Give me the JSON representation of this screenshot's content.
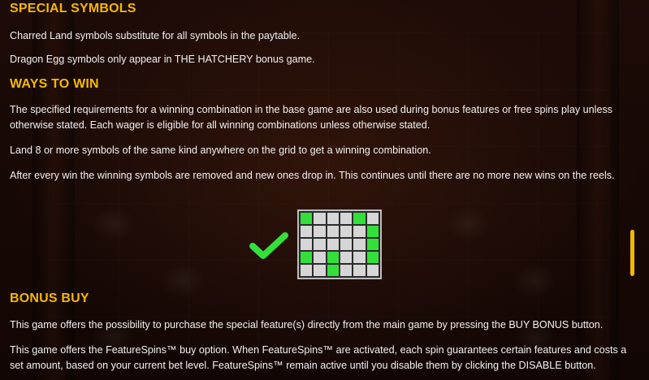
{
  "sections": {
    "special_symbols": {
      "title": "SPECIAL SYMBOLS",
      "p1": "Charred Land symbols substitute for all symbols in the paytable.",
      "p2": "Dragon Egg symbols only appear in THE HATCHERY bonus game."
    },
    "ways_to_win": {
      "title": "WAYS TO WIN",
      "p1": "The specified requirements for a winning combination in the base game are also used during bonus features or free spins play unless otherwise stated. Each wager is eligible for all winning combinations unless otherwise stated.",
      "p2": "Land 8 or more symbols of the same kind anywhere on the grid to get a winning combination.",
      "p3": "After every win the winning symbols are removed and new ones drop in. This continues until there are no more new wins on the reels."
    },
    "bonus_buy": {
      "title": "BONUS BUY",
      "p1": "This game offers the possibility to purchase the special feature(s) directly from the main game by pressing the BUY BONUS button.",
      "p2": "This game offers the FeatureSpins™ buy option. When FeatureSpins™ are activated, each spin guarantees certain features and costs a set amount, based on your current bet level. FeatureSpins™ remain active until you disable them by clicking the DISABLE button."
    }
  },
  "example_grid": {
    "columns": 6,
    "rows": 5,
    "win_cells": [
      [
        0,
        0
      ],
      [
        4,
        0
      ],
      [
        5,
        1
      ],
      [
        5,
        2
      ],
      [
        0,
        3
      ],
      [
        2,
        3
      ],
      [
        5,
        3
      ],
      [
        2,
        4
      ]
    ]
  },
  "colors": {
    "heading": "#f5b800",
    "win_cell": "#33e03a",
    "empty_cell": "#d6d6d6",
    "check": "#33e03a",
    "scroll_thumb": "#f5b800"
  },
  "icons": {
    "check": "checkmark-icon"
  },
  "scroll": {
    "position_fraction": 0.68
  }
}
